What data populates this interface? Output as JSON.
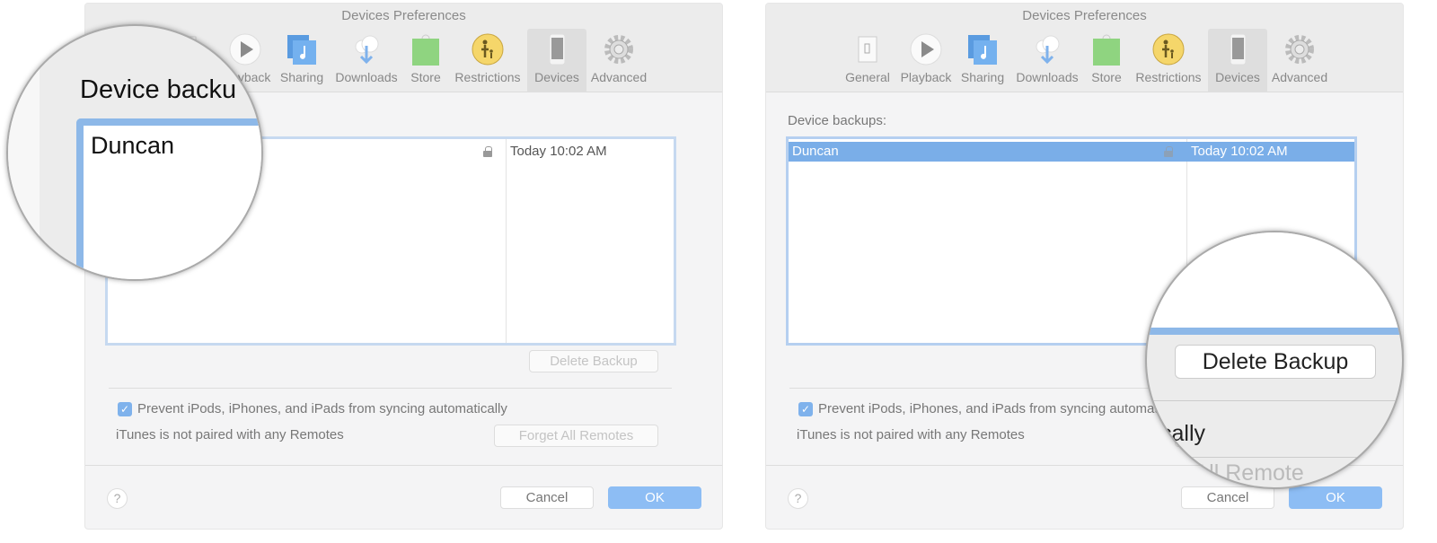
{
  "window": {
    "title": "Devices Preferences"
  },
  "toolbar": [
    {
      "label": "General",
      "icon": "general-switch-icon"
    },
    {
      "label": "Playback",
      "icon": "play-icon"
    },
    {
      "label": "Sharing",
      "icon": "music-note-icon"
    },
    {
      "label": "Downloads",
      "icon": "cloud-download-icon"
    },
    {
      "label": "Store",
      "icon": "shopping-bag-icon"
    },
    {
      "label": "Restrictions",
      "icon": "parental-icon"
    },
    {
      "label": "Devices",
      "icon": "phone-icon",
      "selected": true
    },
    {
      "label": "Advanced",
      "icon": "gear-icon"
    }
  ],
  "backups": {
    "label": "Device backups:",
    "rows": [
      {
        "name": "Duncan",
        "date": "Today 10:02 AM",
        "locked": true
      }
    ]
  },
  "buttons": {
    "delete": "Delete Backup",
    "forget": "Forget All Remotes",
    "cancel": "Cancel",
    "ok": "OK",
    "help": "?"
  },
  "options": {
    "prevent_sync": "Prevent iPods, iPhones, and iPads from syncing automatically",
    "prevent_checked": true,
    "remotes": "iTunes is not paired with any Remotes"
  },
  "magnifier_left": {
    "heading": "Device backu",
    "name": "Duncan"
  },
  "magnifier_right": {
    "button": "Delete Backup",
    "fragment1": "cally",
    "fragment2": "t All Remote"
  },
  "colors": {
    "selection": "#7aaee8",
    "ok": "#8dbdf4",
    "table_border": "#c6d9f0"
  }
}
